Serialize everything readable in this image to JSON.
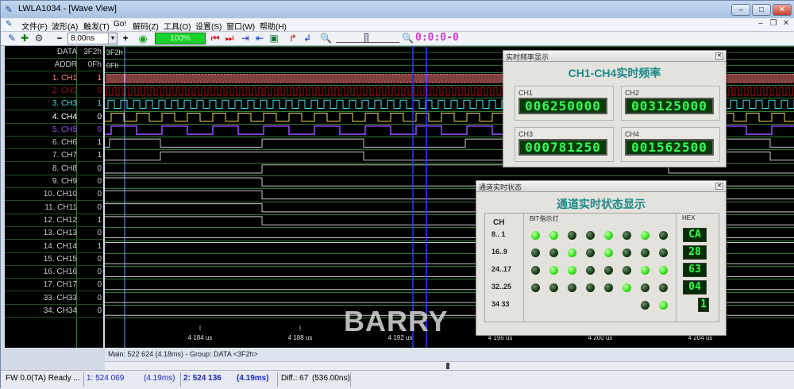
{
  "window": {
    "title": "LWLA1034 - [Wave View]",
    "controls": [
      "–",
      "□",
      "✕"
    ],
    "mdi_controls": [
      "–",
      "❐",
      "✕"
    ]
  },
  "menu": [
    "文件(F)",
    "波形(A)",
    "触发(T)",
    "Go!",
    "解码(Z)",
    "工具(O)",
    "设置(S)",
    "窗口(W)",
    "帮助(H)"
  ],
  "toolbar": {
    "zoom_minus": "−",
    "zoom_value": "8.00ns",
    "zoom_plus": "+",
    "progress": "100%",
    "timer": "0:0:0-0"
  },
  "channels": [
    {
      "name": "DATA",
      "value": "3F2h",
      "color": "#c8c8c8"
    },
    {
      "name": "ADDR",
      "value": "0Fh",
      "color": "#c8c8c8"
    },
    {
      "name": "1. CH1",
      "value": "1",
      "color": "#ff8080"
    },
    {
      "name": "2. CH2",
      "value": "0",
      "color": "#a01010"
    },
    {
      "name": "3. CH3",
      "value": "1",
      "color": "#40e0e0"
    },
    {
      "name": "4. CH4",
      "value": "0",
      "color": "#ffffff"
    },
    {
      "name": "5. CH5",
      "value": "0",
      "color": "#9b4dff"
    },
    {
      "name": "6. CH6",
      "value": "1",
      "color": "#c8c8c8"
    },
    {
      "name": "7. CH7",
      "value": "1",
      "color": "#c8c8c8"
    },
    {
      "name": "8. CH8",
      "value": "0",
      "color": "#c8c8c8"
    },
    {
      "name": "9. CH9",
      "value": "0",
      "color": "#c8c8c8"
    },
    {
      "name": "10. CH10",
      "value": "0",
      "color": "#c8c8c8"
    },
    {
      "name": "11. CH11",
      "value": "0",
      "color": "#c8c8c8"
    },
    {
      "name": "12. CH12",
      "value": "1",
      "color": "#c8c8c8"
    },
    {
      "name": "13. CH13",
      "value": "0",
      "color": "#c8c8c8"
    },
    {
      "name": "14. CH14",
      "value": "1",
      "color": "#c8c8c8"
    },
    {
      "name": "15. CH15",
      "value": "0",
      "color": "#c8c8c8"
    },
    {
      "name": "16. CH16",
      "value": "0",
      "color": "#c8c8c8"
    },
    {
      "name": "17. CH17",
      "value": "0",
      "color": "#c8c8c8"
    },
    {
      "name": "33. CH33",
      "value": "0",
      "color": "#c8c8c8"
    },
    {
      "name": "34. CH34",
      "value": "0",
      "color": "#c8c8c8"
    }
  ],
  "bus": {
    "data": "3F2h",
    "addr": "0Fh"
  },
  "time_axis": [
    "4 184 us",
    "4 188 us",
    "4 192 us",
    "4 196 us",
    "4 200 us",
    "4 204 us"
  ],
  "info_line": "Main: 522 624  (4.18ms) - Group: DATA <3F2h>",
  "status": {
    "fw": "FW 0.0(TA) Ready ...",
    "cursor1_label": "1: 524 069",
    "cursor1_time": "(4.19ms)",
    "cursor2_label": "2: 524 136",
    "cursor2_time": "(4.19ms)",
    "diff": "Diff.: 67",
    "diff_time": "(536.00ns)"
  },
  "freq_dialog": {
    "title": "实时频率显示",
    "heading": "CH1-CH4实时频率",
    "boxes": [
      {
        "label": "CH1",
        "value": "006250000"
      },
      {
        "label": "CH2",
        "value": "003125000"
      },
      {
        "label": "CH3",
        "value": "000781250"
      },
      {
        "label": "CH4",
        "value": "001562500"
      }
    ]
  },
  "state_dialog": {
    "title": "通道实时状态",
    "heading": "通道实时状态显示",
    "ch_header": "CH",
    "bit_header": "BIT指示灯",
    "hex_header": "HEX",
    "rows": [
      {
        "label": "8.. 1",
        "hex": "CA"
      },
      {
        "label": "16..9",
        "hex": "28"
      },
      {
        "label": "24..17",
        "hex": "63"
      },
      {
        "label": "32..25",
        "hex": "04"
      },
      {
        "label": "34  33",
        "hex": "1"
      }
    ],
    "leds": [
      [
        1,
        1,
        0,
        0,
        1,
        0,
        1,
        0
      ],
      [
        0,
        0,
        1,
        0,
        1,
        0,
        0,
        0
      ],
      [
        0,
        1,
        1,
        0,
        0,
        0,
        1,
        1
      ],
      [
        0,
        0,
        0,
        0,
        0,
        1,
        0,
        0
      ],
      [
        0,
        1
      ]
    ]
  },
  "watermark": "BARRY",
  "colors": {
    "grid": "#2f7d2f",
    "cursor": "#2a3cff",
    "trace": "#c8c8c8"
  }
}
